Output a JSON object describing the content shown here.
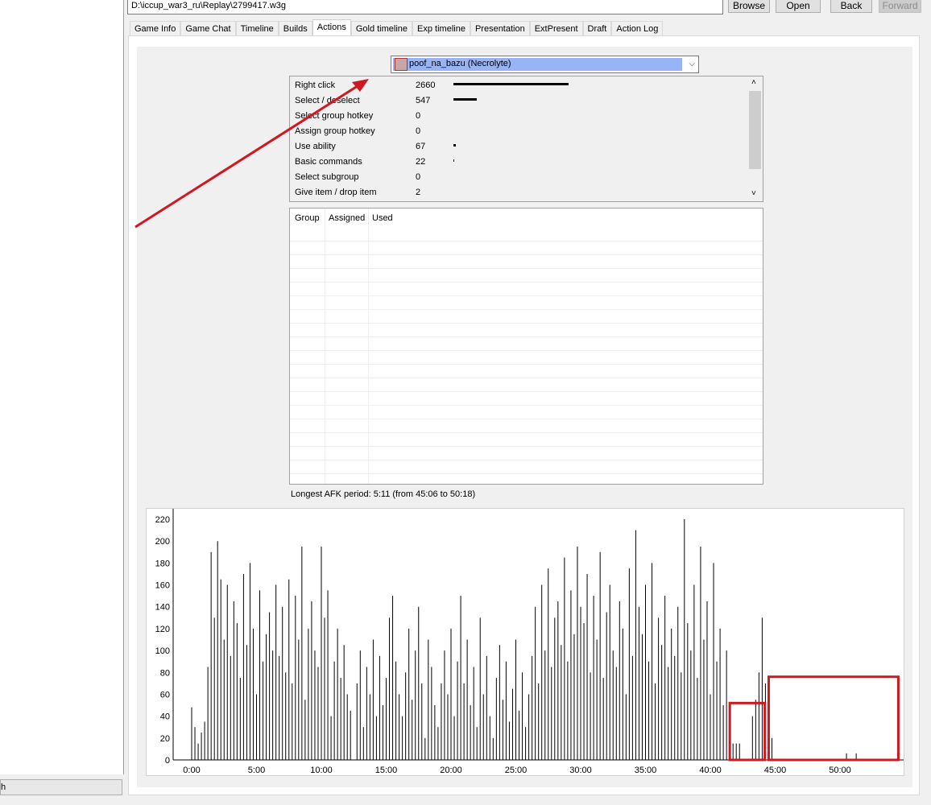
{
  "left_panel": {
    "status_text": "h"
  },
  "toolbar": {
    "path": "D:\\iccup_war3_ru\\Replay\\2799417.w3g",
    "browse_label": "Browse",
    "open_label": "Open",
    "back_label": "Back",
    "forward_label": "Forward"
  },
  "tabs": [
    "Game Info",
    "Game Chat",
    "Timeline",
    "Builds",
    "Actions",
    "Gold timeline",
    "Exp timeline",
    "Presentation",
    "ExtPresent",
    "Draft",
    "Action Log"
  ],
  "active_tab": "Actions",
  "player_select": {
    "selected": "poof_na_bazu (Necrolyte)"
  },
  "actions": [
    {
      "label": "Right click",
      "value": "2660"
    },
    {
      "label": "Select / deselect",
      "value": "547"
    },
    {
      "label": "Select group hotkey",
      "value": "0"
    },
    {
      "label": "Assign group hotkey",
      "value": "0"
    },
    {
      "label": "Use ability",
      "value": "67"
    },
    {
      "label": "Basic commands",
      "value": "22"
    },
    {
      "label": "Select subgroup",
      "value": "0"
    },
    {
      "label": "Give item / drop item",
      "value": "2"
    }
  ],
  "group_table": {
    "columns": [
      "Group",
      "Assigned",
      "Used"
    ],
    "rows": []
  },
  "afk_text": "Longest AFK period: 5:11 (from 45:06 to 50:18)",
  "chart_data": {
    "type": "bar",
    "x_unit": "minutes",
    "x_ticks": [
      "0:00",
      "5:00",
      "10:00",
      "15:00",
      "20:00",
      "25:00",
      "30:00",
      "35:00",
      "40:00",
      "45:00",
      "50:00"
    ],
    "y_ticks": [
      0,
      20,
      40,
      60,
      80,
      100,
      120,
      140,
      160,
      180,
      200,
      220
    ],
    "ylim": [
      0,
      230
    ],
    "xlim": [
      -0.5,
      55
    ],
    "series": [
      {
        "values": [
          [
            0,
            48
          ],
          [
            0.25,
            30
          ],
          [
            0.5,
            15
          ],
          [
            0.75,
            25
          ],
          [
            1,
            35
          ],
          [
            1.25,
            85
          ],
          [
            1.5,
            190
          ],
          [
            1.75,
            130
          ],
          [
            2,
            200
          ],
          [
            2.25,
            165
          ],
          [
            2.5,
            110
          ],
          [
            2.75,
            160
          ],
          [
            3,
            95
          ],
          [
            3.25,
            145
          ],
          [
            3.5,
            125
          ],
          [
            3.75,
            75
          ],
          [
            4,
            170
          ],
          [
            4.25,
            105
          ],
          [
            4.5,
            180
          ],
          [
            4.75,
            120
          ],
          [
            5,
            60
          ],
          [
            5.25,
            155
          ],
          [
            5.5,
            90
          ],
          [
            5.75,
            115
          ],
          [
            6,
            135
          ],
          [
            6.25,
            100
          ],
          [
            6.5,
            160
          ],
          [
            6.75,
            95
          ],
          [
            7,
            140
          ],
          [
            7.25,
            80
          ],
          [
            7.5,
            165
          ],
          [
            7.75,
            70
          ],
          [
            8,
            150
          ],
          [
            8.25,
            110
          ],
          [
            8.5,
            195
          ],
          [
            8.75,
            55
          ],
          [
            9,
            120
          ],
          [
            9.25,
            145
          ],
          [
            9.5,
            100
          ],
          [
            9.75,
            85
          ],
          [
            10,
            195
          ],
          [
            10.25,
            130
          ],
          [
            10.5,
            155
          ],
          [
            10.75,
            40
          ],
          [
            11,
            90
          ],
          [
            11.25,
            120
          ],
          [
            11.5,
            75
          ],
          [
            11.75,
            105
          ],
          [
            12,
            60
          ],
          [
            12.25,
            45
          ],
          [
            12.75,
            70
          ],
          [
            13,
            100
          ],
          [
            13.25,
            30
          ],
          [
            13.5,
            85
          ],
          [
            13.75,
            60
          ],
          [
            14,
            110
          ],
          [
            14.25,
            40
          ],
          [
            14.5,
            95
          ],
          [
            14.75,
            50
          ],
          [
            15,
            75
          ],
          [
            15.25,
            130
          ],
          [
            15.5,
            150
          ],
          [
            15.75,
            90
          ],
          [
            16,
            60
          ],
          [
            16.25,
            40
          ],
          [
            16.5,
            80
          ],
          [
            16.75,
            120
          ],
          [
            17,
            55
          ],
          [
            17.25,
            100
          ],
          [
            17.5,
            140
          ],
          [
            17.75,
            70
          ],
          [
            18,
            20
          ],
          [
            18.25,
            110
          ],
          [
            18.5,
            85
          ],
          [
            18.75,
            50
          ],
          [
            19,
            30
          ],
          [
            19.25,
            70
          ],
          [
            19.5,
            100
          ],
          [
            19.75,
            60
          ],
          [
            20,
            120
          ],
          [
            20.25,
            40
          ],
          [
            20.5,
            90
          ],
          [
            20.75,
            150
          ],
          [
            21,
            70
          ],
          [
            21.25,
            110
          ],
          [
            21.5,
            50
          ],
          [
            21.75,
            85
          ],
          [
            22,
            30
          ],
          [
            22.25,
            130
          ],
          [
            22.5,
            60
          ],
          [
            22.75,
            95
          ],
          [
            23,
            40
          ],
          [
            23.25,
            20
          ],
          [
            23.5,
            75
          ],
          [
            23.75,
            105
          ],
          [
            24,
            55
          ],
          [
            24.25,
            90
          ],
          [
            24.5,
            35
          ],
          [
            24.75,
            65
          ],
          [
            25,
            110
          ],
          [
            25.25,
            45
          ],
          [
            25.5,
            80
          ],
          [
            25.75,
            30
          ],
          [
            26,
            60
          ],
          [
            26.25,
            95
          ],
          [
            26.5,
            140
          ],
          [
            26.75,
            70
          ],
          [
            27,
            160
          ],
          [
            27.25,
            100
          ],
          [
            27.5,
            175
          ],
          [
            27.75,
            85
          ],
          [
            28,
            130
          ],
          [
            28.25,
            145
          ],
          [
            28.5,
            105
          ],
          [
            28.75,
            185
          ],
          [
            29,
            90
          ],
          [
            29.25,
            155
          ],
          [
            29.5,
            115
          ],
          [
            29.75,
            195
          ],
          [
            30,
            140
          ],
          [
            30.25,
            125
          ],
          [
            30.5,
            170
          ],
          [
            30.75,
            80
          ],
          [
            31,
            150
          ],
          [
            31.25,
            110
          ],
          [
            31.5,
            190
          ],
          [
            31.75,
            75
          ],
          [
            32,
            135
          ],
          [
            32.25,
            160
          ],
          [
            32.5,
            100
          ],
          [
            32.75,
            85
          ],
          [
            33,
            145
          ],
          [
            33.25,
            120
          ],
          [
            33.5,
            60
          ],
          [
            33.75,
            175
          ],
          [
            34,
            95
          ],
          [
            34.25,
            210
          ],
          [
            34.5,
            140
          ],
          [
            34.75,
            115
          ],
          [
            35,
            160
          ],
          [
            35.25,
            90
          ],
          [
            35.5,
            180
          ],
          [
            35.75,
            70
          ],
          [
            36,
            130
          ],
          [
            36.25,
            105
          ],
          [
            36.5,
            150
          ],
          [
            36.75,
            85
          ],
          [
            37,
            120
          ],
          [
            37.25,
            95
          ],
          [
            37.5,
            140
          ],
          [
            37.75,
            80
          ],
          [
            38,
            220
          ],
          [
            38.25,
            125
          ],
          [
            38.5,
            100
          ],
          [
            38.75,
            160
          ],
          [
            39,
            75
          ],
          [
            39.25,
            195
          ],
          [
            39.5,
            110
          ],
          [
            39.75,
            145
          ],
          [
            40,
            60
          ],
          [
            40.25,
            180
          ],
          [
            40.5,
            90
          ],
          [
            40.75,
            120
          ],
          [
            41,
            50
          ],
          [
            41.25,
            100
          ],
          [
            41.75,
            15
          ],
          [
            42,
            15
          ],
          [
            42.25,
            15
          ],
          [
            43.25,
            40
          ],
          [
            43.5,
            55
          ],
          [
            43.75,
            80
          ],
          [
            44,
            130
          ],
          [
            44.25,
            70
          ],
          [
            44.5,
            45
          ],
          [
            44.75,
            20
          ],
          [
            50.5,
            6
          ],
          [
            51.25,
            6
          ]
        ]
      }
    ],
    "annotations": [
      "red-rectangle-41.5-44.2",
      "red-rectangle-44.5-54.5"
    ],
    "grid": false,
    "legend": "none"
  }
}
